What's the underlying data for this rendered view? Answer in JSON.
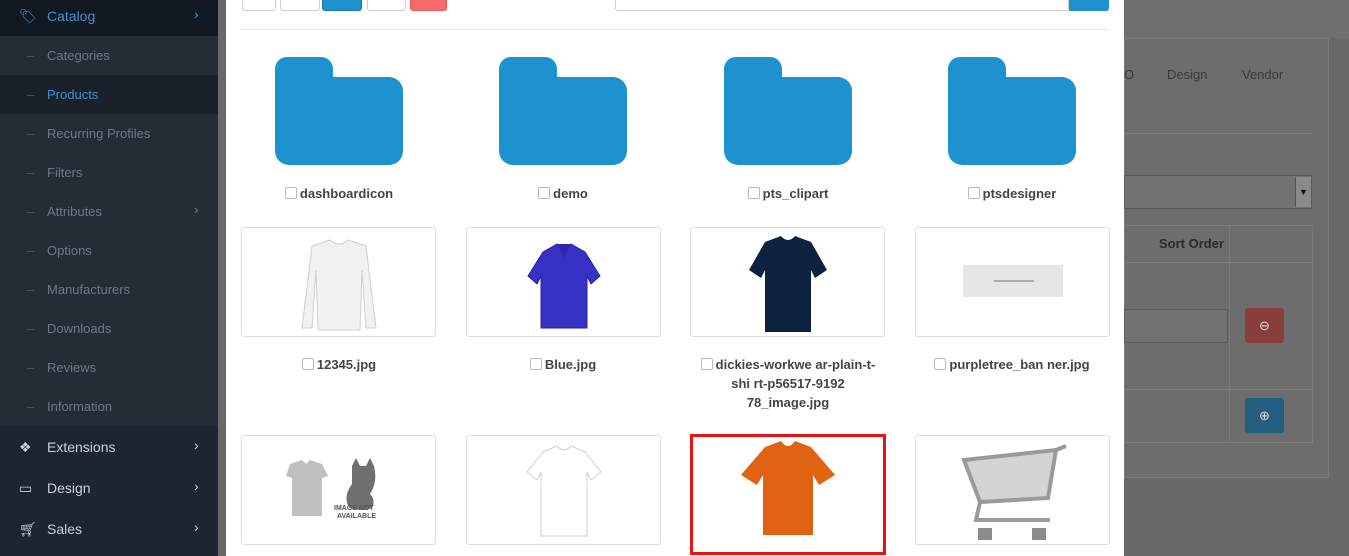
{
  "sidebar": {
    "catalog": {
      "label": "Catalog",
      "icon": "tag-icon"
    },
    "items": [
      {
        "label": "Categories",
        "active": false
      },
      {
        "label": "Products",
        "active": true
      },
      {
        "label": "Recurring Profiles",
        "active": false
      },
      {
        "label": "Filters",
        "active": false
      },
      {
        "label": "Attributes",
        "active": false,
        "has_children": true
      },
      {
        "label": "Options",
        "active": false
      },
      {
        "label": "Manufacturers",
        "active": false
      },
      {
        "label": "Downloads",
        "active": false
      },
      {
        "label": "Reviews",
        "active": false
      },
      {
        "label": "Information",
        "active": false
      }
    ],
    "sections": [
      {
        "label": "Extensions",
        "icon": "puzzle-icon"
      },
      {
        "label": "Design",
        "icon": "monitor-icon"
      },
      {
        "label": "Sales",
        "icon": "cart-icon"
      }
    ]
  },
  "background": {
    "tabs": [
      "O",
      "Design",
      "Vendor"
    ],
    "table_header": "Sort Order"
  },
  "filemanager": {
    "folders": [
      {
        "name": "dashboardicon"
      },
      {
        "name": "demo"
      },
      {
        "name": "pts_clipart"
      },
      {
        "name": "ptsdesigner"
      }
    ],
    "images": [
      {
        "name": "12345.jpg"
      },
      {
        "name": "Blue.jpg"
      },
      {
        "name": "dickies-workwe ar-plain-t-shi rt-p56517-9192 78_image.jpg"
      },
      {
        "name": "purpletree_ban ner.jpg"
      }
    ],
    "selected_index": 2,
    "colors": {
      "folder": "#1e91cf",
      "selected_border": "#e81414",
      "primary": "#1e91cf",
      "danger": "#f56b6b"
    }
  }
}
